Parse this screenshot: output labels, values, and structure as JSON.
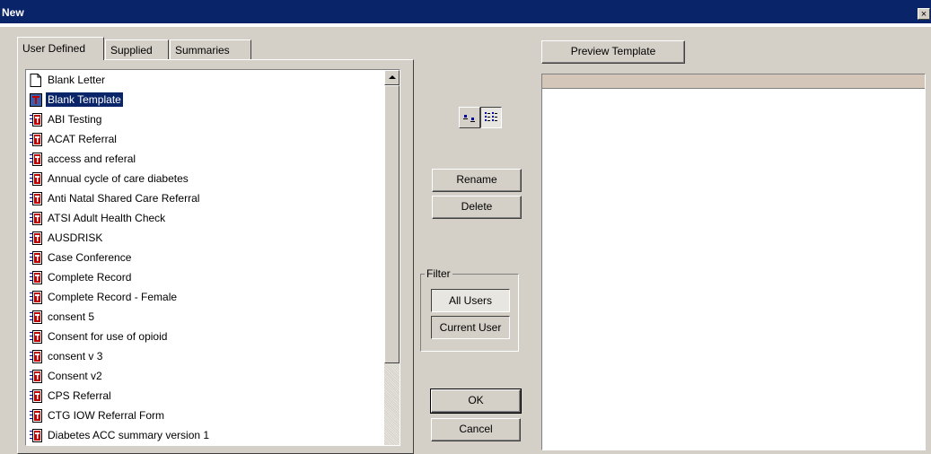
{
  "window": {
    "title": "New",
    "close_glyph": "×"
  },
  "tabs": [
    {
      "label": "User Defined",
      "active": true
    },
    {
      "label": "Supplied",
      "active": false
    },
    {
      "label": "Summaries",
      "active": false
    }
  ],
  "templates": [
    {
      "label": "Blank Letter",
      "icon": "document-icon",
      "selected": false
    },
    {
      "label": "Blank Template",
      "icon": "template-icon",
      "selected": true
    },
    {
      "label": "ABI Testing",
      "icon": "form-template-icon",
      "selected": false
    },
    {
      "label": "ACAT Referral",
      "icon": "form-template-icon",
      "selected": false
    },
    {
      "label": "access and referal",
      "icon": "form-template-icon",
      "selected": false
    },
    {
      "label": "Annual cycle of care diabetes",
      "icon": "form-template-icon",
      "selected": false
    },
    {
      "label": "Anti Natal Shared Care Referral",
      "icon": "form-template-icon",
      "selected": false
    },
    {
      "label": "ATSI Adult Health Check",
      "icon": "form-template-icon",
      "selected": false
    },
    {
      "label": "AUSDRISK",
      "icon": "form-template-icon",
      "selected": false
    },
    {
      "label": "Case Conference",
      "icon": "form-template-icon",
      "selected": false
    },
    {
      "label": "Complete Record",
      "icon": "form-template-icon",
      "selected": false
    },
    {
      "label": "Complete Record - Female",
      "icon": "form-template-icon",
      "selected": false
    },
    {
      "label": "consent 5",
      "icon": "form-template-icon",
      "selected": false
    },
    {
      "label": "Consent for use of opioid",
      "icon": "form-template-icon",
      "selected": false
    },
    {
      "label": "consent v 3",
      "icon": "form-template-icon",
      "selected": false
    },
    {
      "label": "Consent v2",
      "icon": "form-template-icon",
      "selected": false
    },
    {
      "label": "CPS Referral",
      "icon": "form-template-icon",
      "selected": false
    },
    {
      "label": "CTG IOW Referral Form",
      "icon": "form-template-icon",
      "selected": false
    },
    {
      "label": "Diabetes ACC summary version 1",
      "icon": "form-template-icon",
      "selected": false
    }
  ],
  "buttons": {
    "preview": "Preview Template",
    "rename": "Rename",
    "delete": "Delete",
    "ok": "OK",
    "cancel": "Cancel"
  },
  "view_toggle": {
    "options": [
      "small-icons-view-icon",
      "list-view-icon"
    ],
    "selected": "list-view-icon"
  },
  "filter": {
    "legend": "Filter",
    "options": [
      "All Users",
      "Current User"
    ]
  },
  "colors": {
    "titlebar": "#0a246a",
    "selection": "#0a246a",
    "face": "#d4d0c8",
    "form_icon_red": "#c00000"
  }
}
